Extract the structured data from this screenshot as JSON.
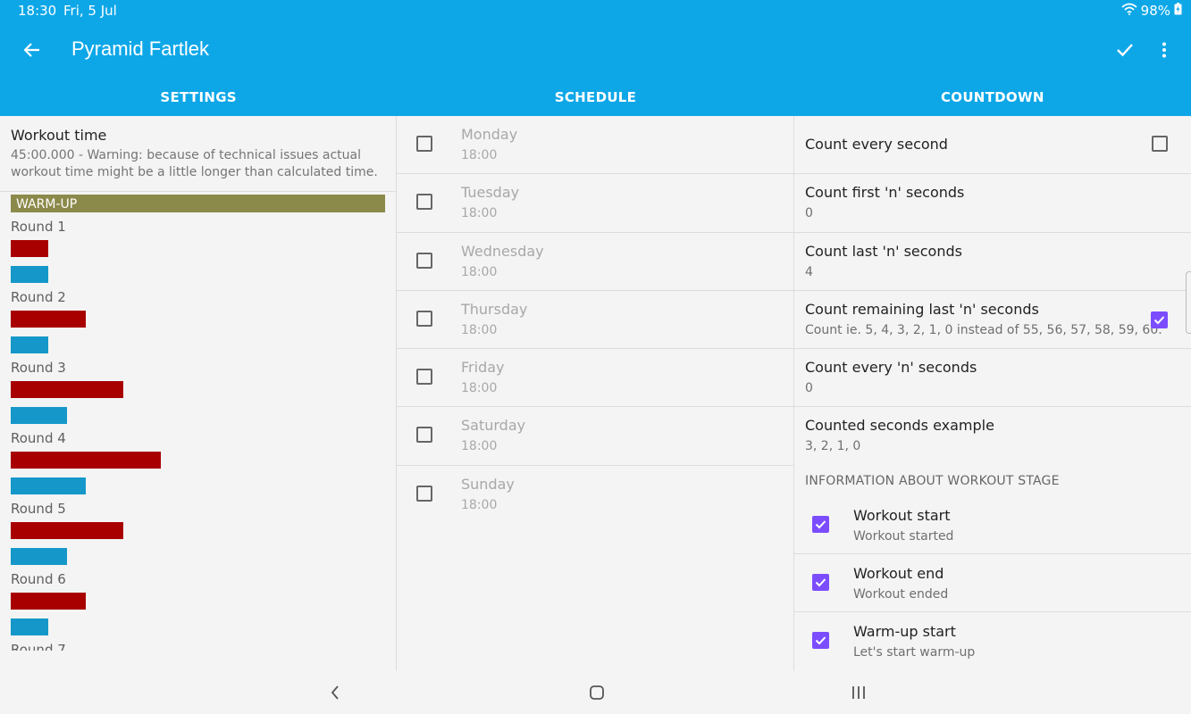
{
  "status_bar": {
    "time": "18:30",
    "date": "Fri, 5 Jul",
    "battery": "98%"
  },
  "app_bar": {
    "title": "Pyramid Fartlek"
  },
  "tabs": [
    "SETTINGS",
    "SCHEDULE",
    "COUNTDOWN"
  ],
  "settings": {
    "workout_time_title": "Workout time",
    "workout_time_value": "45:00.000 - Warning: because of technical issues actual workout time might be a little longer than calculated time.",
    "stage_label": "WARM-UP",
    "colors": {
      "stage": "#8c8a4b",
      "work_bar": "#a80000",
      "rest_bar": "#1598c9"
    },
    "rounds": [
      {
        "label": "Round 1"
      },
      {
        "label": "Round 2"
      },
      {
        "label": "Round 3"
      },
      {
        "label": "Round 4"
      },
      {
        "label": "Round 5"
      },
      {
        "label": "Round 6"
      }
    ],
    "next_round_partial": "Round 7"
  },
  "schedule": {
    "days": [
      {
        "name": "Monday",
        "time": "18:00",
        "checked": false
      },
      {
        "name": "Tuesday",
        "time": "18:00",
        "checked": false
      },
      {
        "name": "Wednesday",
        "time": "18:00",
        "checked": false
      },
      {
        "name": "Thursday",
        "time": "18:00",
        "checked": false
      },
      {
        "name": "Friday",
        "time": "18:00",
        "checked": false
      },
      {
        "name": "Saturday",
        "time": "18:00",
        "checked": false
      },
      {
        "name": "Sunday",
        "time": "18:00",
        "checked": false
      }
    ]
  },
  "countdown": {
    "prefs": [
      {
        "title": "Count every second",
        "checked": false
      },
      {
        "title": "Count first 'n' seconds",
        "value": "0"
      },
      {
        "title": "Count last 'n' seconds",
        "value": "4"
      },
      {
        "title": "Count remaining last 'n' seconds",
        "value": "Count ie. 5, 4, 3, 2, 1, 0 instead of 55, 56, 57, 58, 59, 60.",
        "checked": true
      },
      {
        "title": "Count every 'n' seconds",
        "value": "0"
      },
      {
        "title": "Counted seconds example",
        "value": "3, 2, 1, 0"
      }
    ],
    "section_header": "INFORMATION ABOUT WORKOUT STAGE",
    "info_items": [
      {
        "title": "Workout start",
        "value": "Workout started",
        "checked": true
      },
      {
        "title": "Workout end",
        "value": "Workout ended",
        "checked": true
      },
      {
        "title": "Warm-up start",
        "value": "Let's start warm-up",
        "checked": true
      }
    ],
    "accent_color": "#7c4dff"
  },
  "theme": {
    "primary": "#0da7e8"
  }
}
